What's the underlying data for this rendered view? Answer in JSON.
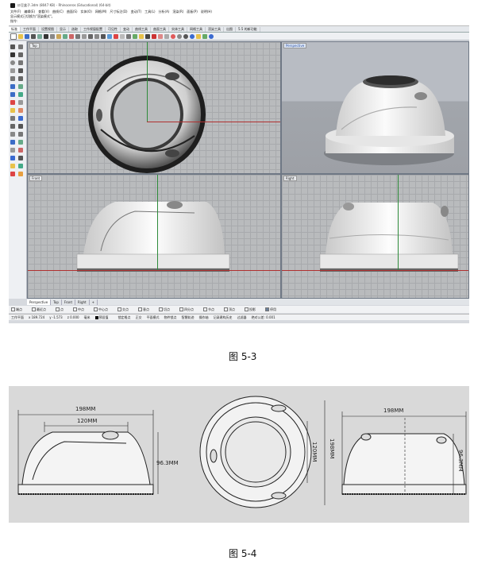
{
  "app": {
    "title": "炒豆盒子.3dm (8047 KB) - Rhinoceros (Educational) (64-bit)"
  },
  "menu": {
    "items": [
      "文件(F)",
      "编辑(E)",
      "查看(V)",
      "曲线(C)",
      "曲面(S)",
      "实体(O)",
      "网格(M)",
      "尺寸标注(D)",
      "变动(T)",
      "工具(L)",
      "分析(A)",
      "渲染(R)",
      "面板(P)",
      "说明(H)"
    ]
  },
  "command": {
    "history1": "显示模式已切换为\"渲染模式\"。",
    "prompt": "指令:"
  },
  "tabs": {
    "items": [
      "标准",
      "工作平面",
      "设置视图",
      "显示",
      "选取",
      "工作视窗配置",
      "可见性",
      "变动",
      "曲线工具",
      "曲面工具",
      "实体工具",
      "网格工具",
      "渲染工具",
      "出图",
      "5.5 的新功能"
    ],
    "active_index": 0
  },
  "viewports": {
    "top": {
      "label": "Top"
    },
    "perspective": {
      "label": "Perspective"
    },
    "front": {
      "label": "Front"
    },
    "right": {
      "label": "Right"
    }
  },
  "viewport_tabs": {
    "items": [
      "Perspective",
      "Top",
      "Front",
      "Right",
      "+"
    ],
    "active_index": 0
  },
  "osnap": {
    "items": [
      "端点",
      "最近点",
      "点",
      "中点",
      "中心点",
      "交点",
      "垂点",
      "切点",
      "四分点",
      "节点",
      "顶点",
      "投影",
      "停用"
    ]
  },
  "status": {
    "plane": "工作平面",
    "x": "x 189.724",
    "y": "y -1.573",
    "z": "z 0.000",
    "unit": "毫米",
    "layer": "预设值",
    "items": [
      "锁定格点",
      "正交",
      "平面模式",
      "物件锁点",
      "智慧轨迹",
      "操作轴",
      "记录建构历史",
      "过滤器",
      "绝对公差: 0.001"
    ]
  },
  "captions": {
    "fig1": "图 5-3",
    "fig2": "图 5-4"
  },
  "dimensions": {
    "front_width": "198MM",
    "front_inner": "120MM",
    "front_height": "96.3MM",
    "top_outer": "198MM",
    "top_inner": "120MM",
    "side_width": "198MM",
    "side_height": "96.3MM"
  },
  "colors": {
    "viewport_bg": "#b9bbbd",
    "grid": "#a8aaad",
    "axis_x": "#b03030",
    "axis_y": "#2e8b3a",
    "active_label": "#2a4da0"
  }
}
